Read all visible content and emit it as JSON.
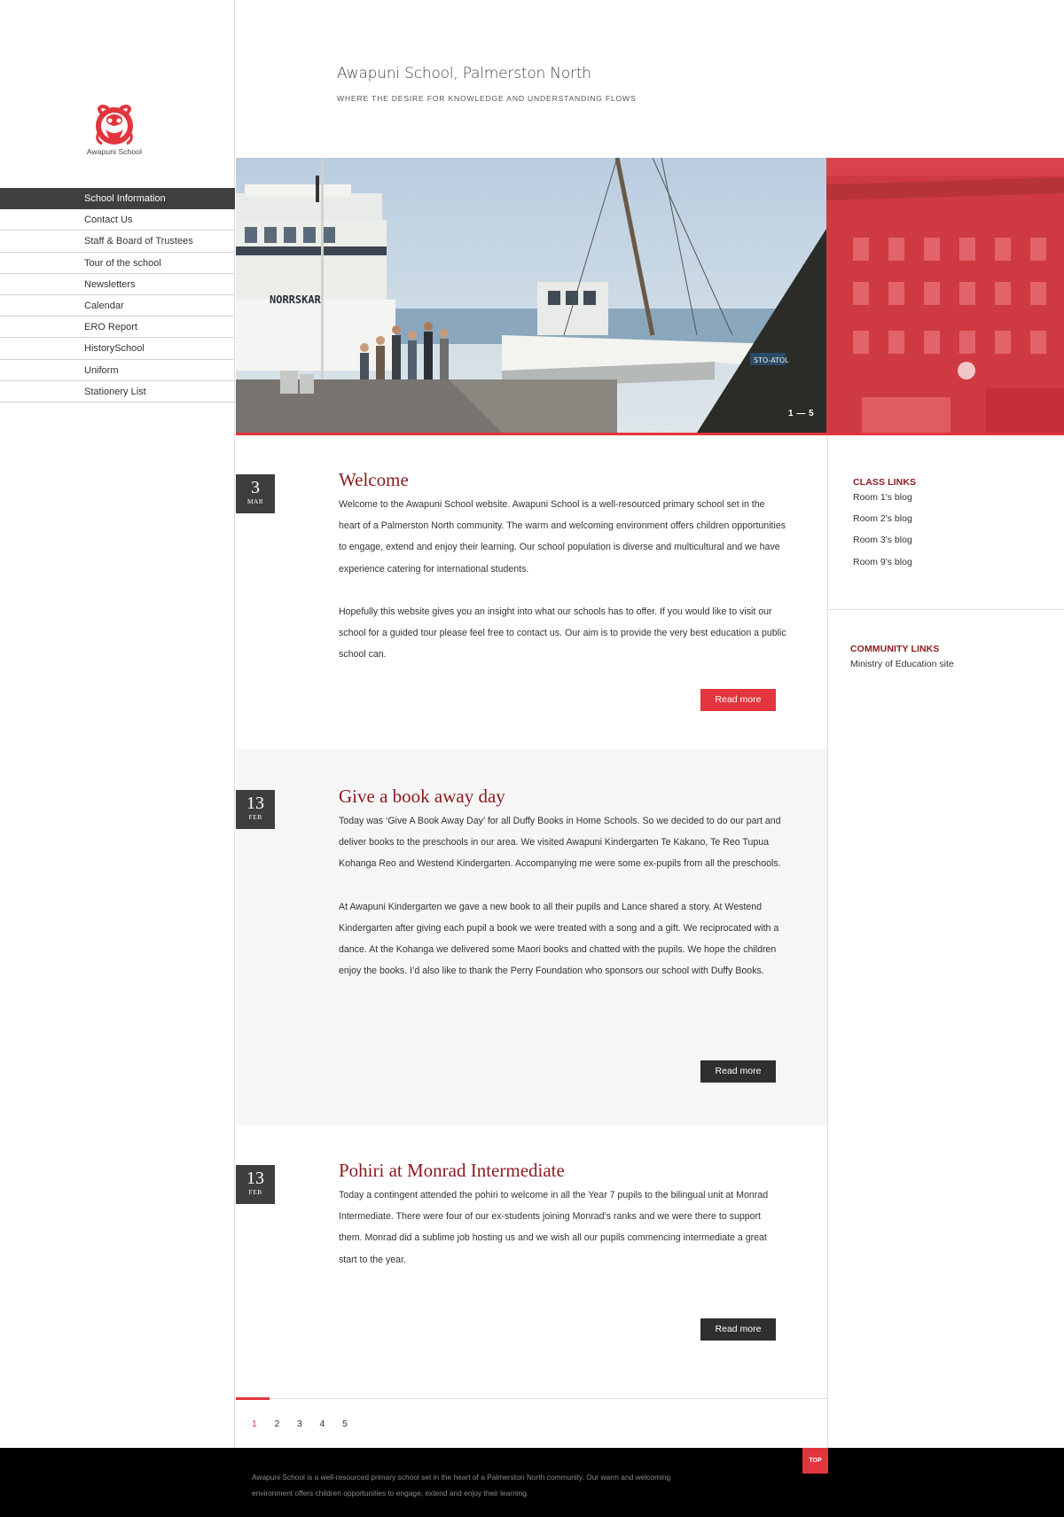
{
  "brand": {
    "logo_text": "Awapuni School",
    "site_title": "Awapuni School, Palmerston North",
    "tagline": "WHERE THE DESIRE FOR KNOWLEDGE AND UNDERSTANDING FLOWS"
  },
  "nav": {
    "items": [
      {
        "label": "School Information",
        "active": true
      },
      {
        "label": "Contact Us"
      },
      {
        "label": "Staff & Board of Trustees"
      },
      {
        "label": "Tour of the school"
      },
      {
        "label": "Newsletters"
      },
      {
        "label": "Calendar"
      },
      {
        "label": "ERO Report"
      },
      {
        "label": "HistorySchool"
      },
      {
        "label": "Uniform"
      },
      {
        "label": "Stationery List"
      }
    ]
  },
  "hero": {
    "counter": "1 — 5",
    "boat_name": "NORRSKAR",
    "sign_text": "STO-ATOL",
    "overlay_color": "#d9434b"
  },
  "posts": [
    {
      "day": "3",
      "month": "MAR",
      "title": "Welcome",
      "paragraphs": [
        "Welcome to the Awapuni School website.  Awapuni School is a well-resourced primary school set in the heart of a Palmerston North community. The warm and welcoming environment offers children opportunities to engage, extend and enjoy their learning.  Our school population is diverse and multicultural and we have experience catering for international students.",
        "Hopefully this website gives you an insight into what our schools has to offer.  If you would like to visit our school for a guided tour please feel free to contact us.  Our aim is to provide the very best education a public school can."
      ],
      "button": "Read more"
    },
    {
      "day": "13",
      "month": "FEB",
      "title": "Give a book away day",
      "paragraphs": [
        "Today was ‘Give A Book Away Day’ for all Duffy Books in Home Schools.  So we decided to do our part and deliver books to the preschools in our area.  We visited Awapuni Kindergarten Te Kakano, Te Reo Tupua Kohanga Reo and Westend Kindergarten.  Accompanying me were some ex-pupils from all the preschools.",
        "At Awapuni Kindergarten we gave a new book to all their pupils and Lance shared a story.  At Westend Kindergarten after giving each pupil a book we were treated with a song and a gift.  We reciprocated with a dance. At the Kohanga we delivered some Maori books and chatted with the pupils.  We hope the children enjoy the books.  I’d also like to thank the Perry Foundation who sponsors our school with Duffy Books."
      ],
      "button": "Read more"
    },
    {
      "day": "13",
      "month": "FEB",
      "title": "Pohiri at Monrad Intermediate",
      "paragraphs": [
        "Today a contingent attended the pohiri to welcome in all the Year 7 pupils to the bilingual unit at Monrad Intermediate.  There were four of our ex-students joining Monrad’s ranks and we were there to support them.  Monrad did a sublime job hosting us and we wish all our pupils commencing intermediate a great start to the year."
      ],
      "button": "Read more"
    }
  ],
  "pager": {
    "pages": [
      "1",
      "2",
      "3",
      "4",
      "5"
    ],
    "current": "1"
  },
  "class_links": {
    "heading": "CLASS LINKS",
    "items": [
      "Room 1's blog",
      "Room 2's blog",
      "Room 3's blog",
      "Room 9's blog"
    ]
  },
  "community_links": {
    "heading": "COMMUNITY LINKS",
    "items": [
      "Ministry of Education site"
    ]
  },
  "footer": {
    "text": "Awapuni School is a well-resourced primary school set in the heart of a Palmerston North community. Our warm and welcoming environment offers children opportunities to engage, extend and enjoy their learning.",
    "top_label": "TOP"
  },
  "colors": {
    "accent": "#e2353d",
    "title_red": "#8b1a1f",
    "dark": "#3e3e3e"
  }
}
